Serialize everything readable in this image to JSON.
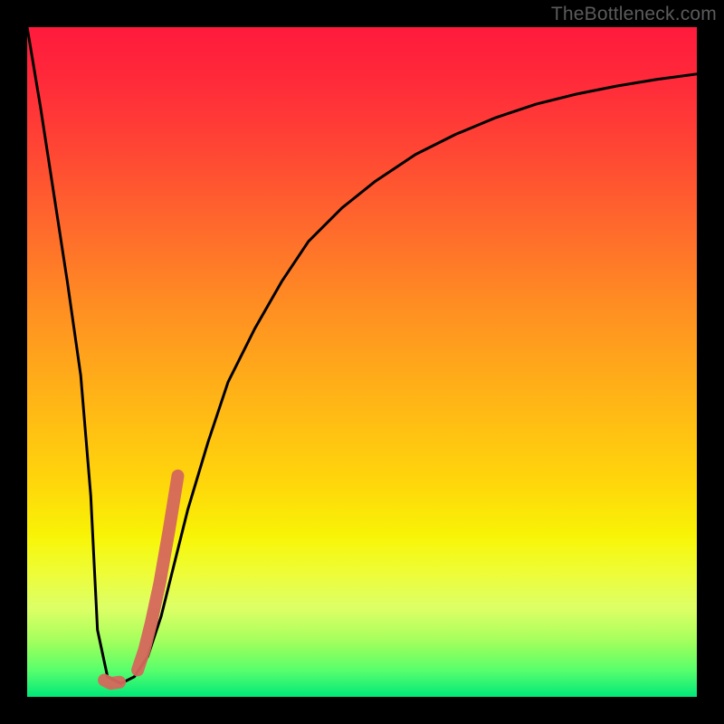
{
  "watermark": "TheBottleneck.com",
  "colors": {
    "curve": "#000000",
    "highlight": "#d5675c",
    "background_black": "#000000"
  },
  "chart_data": {
    "type": "line",
    "title": "",
    "xlabel": "",
    "ylabel": "",
    "xlim": [
      0,
      100
    ],
    "ylim": [
      0,
      100
    ],
    "grid": false,
    "legend": false,
    "series": [
      {
        "name": "bottleneck-curve",
        "x": [
          0,
          2,
          4,
          6,
          8,
          9.5,
          10.5,
          12,
          14,
          16,
          18,
          20,
          22,
          24,
          27,
          30,
          34,
          38,
          42,
          47,
          52,
          58,
          64,
          70,
          76,
          82,
          88,
          94,
          100
        ],
        "y": [
          100,
          88,
          75,
          62,
          48,
          30,
          10,
          3,
          2,
          3,
          6,
          12,
          20,
          28,
          38,
          47,
          55,
          62,
          68,
          73,
          77,
          81,
          84,
          86.5,
          88.5,
          90,
          91.2,
          92.2,
          93
        ]
      }
    ],
    "highlights": [
      {
        "name": "right-branch-highlight",
        "x": [
          16.5,
          17.5,
          18.5,
          19.8,
          21.2,
          22.5
        ],
        "y": [
          4,
          7,
          11,
          17,
          25,
          33
        ]
      },
      {
        "name": "trough-highlight",
        "x": [
          11.5,
          12.5,
          13.8
        ],
        "y": [
          2.5,
          2.0,
          2.2
        ]
      }
    ]
  }
}
